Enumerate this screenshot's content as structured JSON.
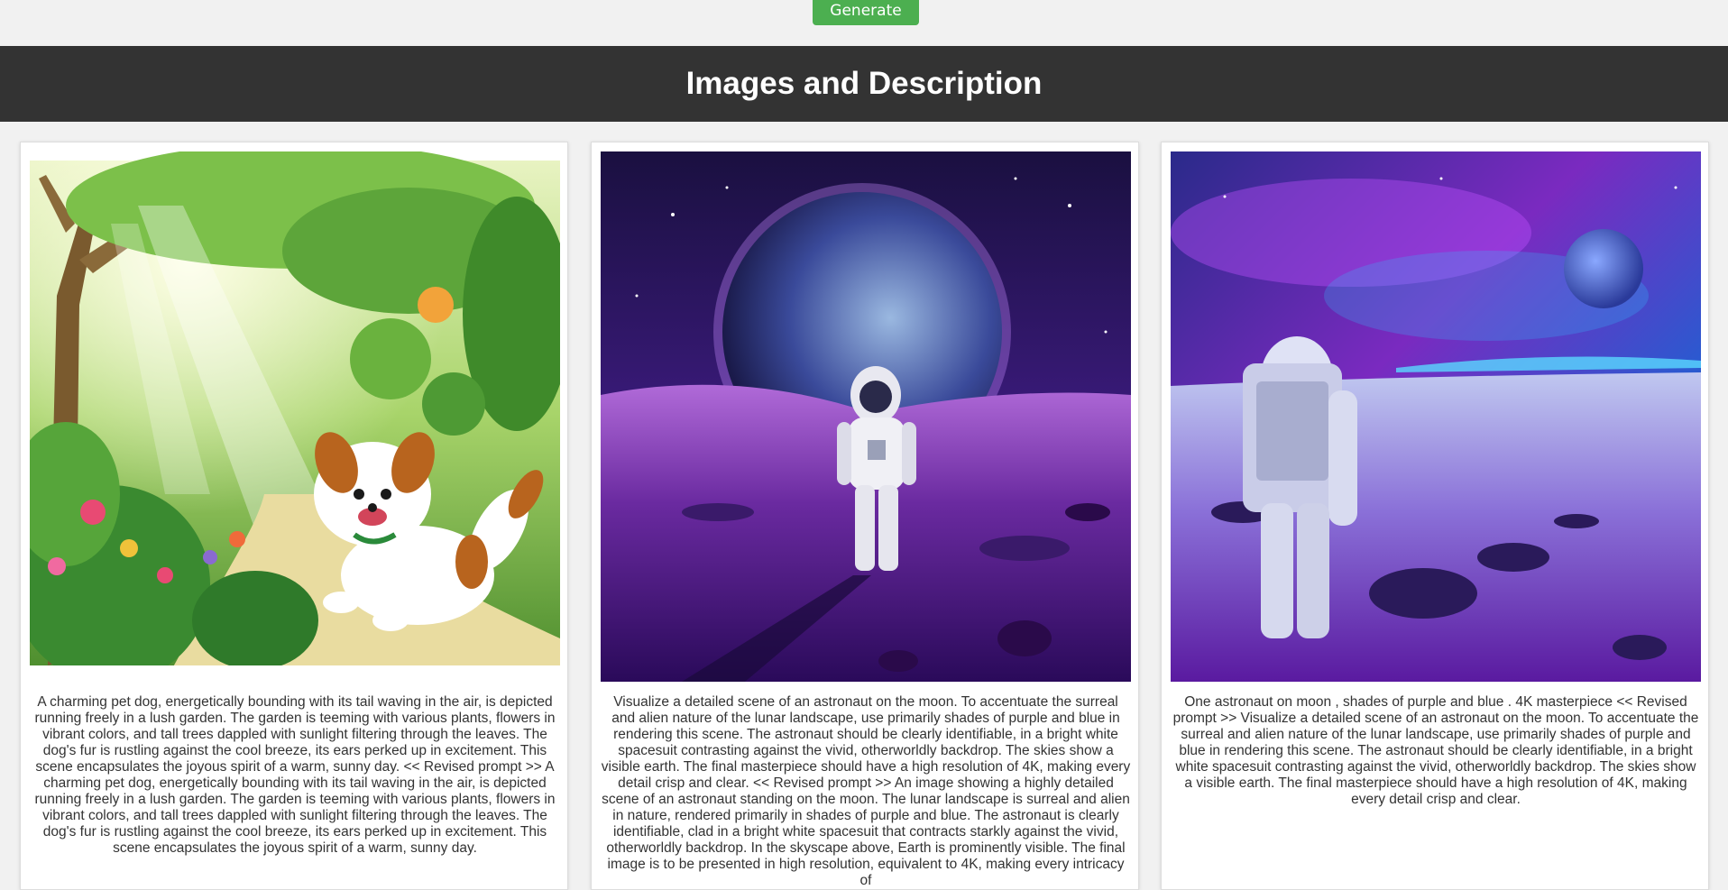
{
  "toolbar": {
    "generate_label": "Generate",
    "button_color": "#4caf50"
  },
  "header": {
    "title": "Images and Description",
    "background": "#333333"
  },
  "cards": [
    {
      "image_subject": "puppy-in-garden",
      "description": "A charming pet dog, energetically bounding with its tail waving in the air, is depicted running freely in a lush garden. The garden is teeming with various plants, flowers in vibrant colors, and tall trees dappled with sunlight filtering through the leaves. The dog's fur is rustling against the cool breeze, its ears perked up in excitement. This scene encapsulates the joyous spirit of a warm, sunny day. << Revised prompt >> A charming pet dog, energetically bounding with its tail waving in the air, is depicted running freely in a lush garden. The garden is teeming with various plants, flowers in vibrant colors, and tall trees dappled with sunlight filtering through the leaves. The dog's fur is rustling against the cool breeze, its ears perked up in excitement. This scene encapsulates the joyous spirit of a warm, sunny day."
    },
    {
      "image_subject": "astronaut-facing-earth-on-purple-moon",
      "description": "Visualize a detailed scene of an astronaut on the moon. To accentuate the surreal and alien nature of the lunar landscape, use primarily shades of purple and blue in rendering this scene. The astronaut should be clearly identifiable, in a bright white spacesuit contrasting against the vivid, otherworldly backdrop. The skies show a visible earth. The final masterpiece should have a high resolution of 4K, making every detail crisp and clear. << Revised prompt >> An image showing a highly detailed scene of an astronaut standing on the moon. The lunar landscape is surreal and alien in nature, rendered primarily in shades of purple and blue. The astronaut is clearly identifiable, clad in a bright white spacesuit that contracts starkly against the vivid, otherworldly backdrop. In the skyscape above, Earth is prominently visible. The final image is to be presented in high resolution, equivalent to 4K, making every intricacy of"
    },
    {
      "image_subject": "astronaut-back-view-on-cratered-moon",
      "description": "One astronaut on moon , shades of purple and blue . 4K masterpiece << Revised prompt >> Visualize a detailed scene of an astronaut on the moon. To accentuate the surreal and alien nature of the lunar landscape, use primarily shades of purple and blue in rendering this scene. The astronaut should be clearly identifiable, in a bright white spacesuit contrasting against the vivid, otherworldly backdrop. The skies show a visible earth. The final masterpiece should have a high resolution of 4K, making every detail crisp and clear."
    }
  ]
}
